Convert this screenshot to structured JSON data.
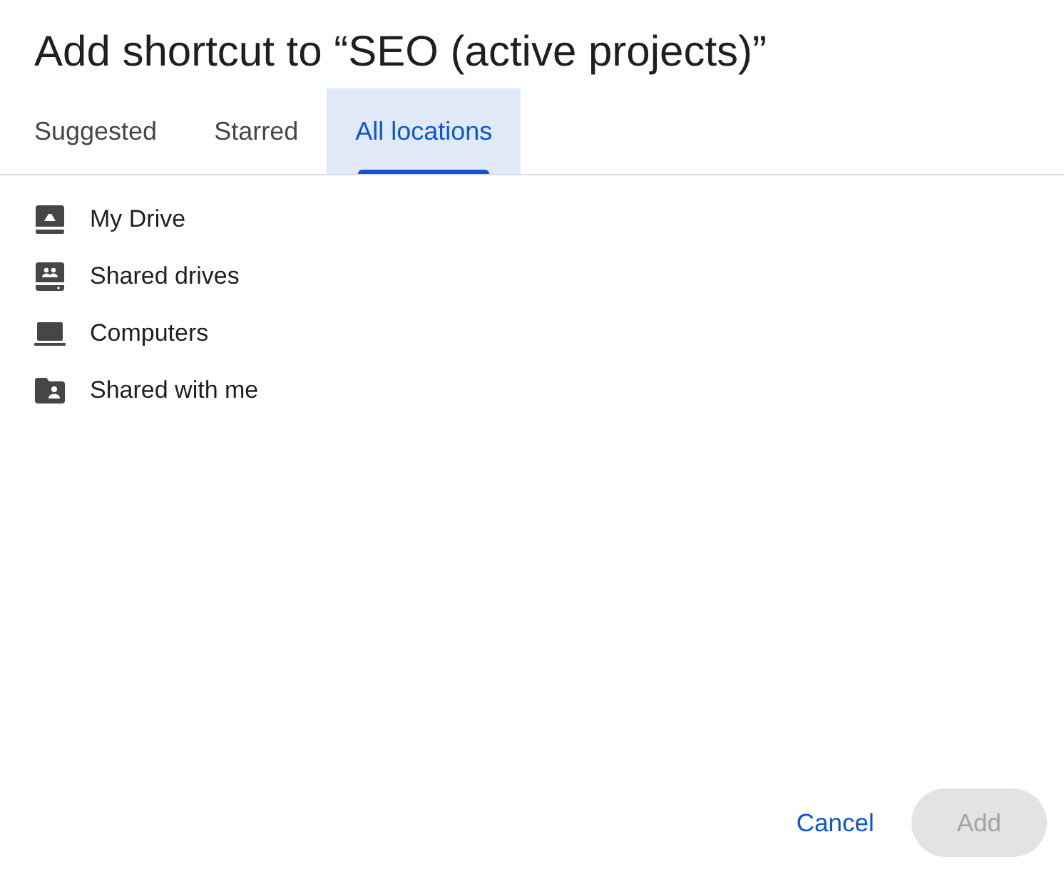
{
  "dialog": {
    "title": "Add shortcut to “SEO (active projects)”"
  },
  "tabs": [
    {
      "label": "Suggested",
      "selected": false
    },
    {
      "label": "Starred",
      "selected": false
    },
    {
      "label": "All locations",
      "selected": true
    }
  ],
  "locations": [
    {
      "kind": "drive",
      "label": "My Drive"
    },
    {
      "kind": "shared-drive",
      "label": "Shared drives"
    },
    {
      "kind": "computer",
      "label": "Computers"
    },
    {
      "kind": "shared-folder",
      "label": "Shared with me"
    }
  ],
  "buttons": [
    {
      "kind": "text",
      "label": "Cancel",
      "disabled": false
    },
    {
      "kind": "filled",
      "label": "Add",
      "disabled": true
    }
  ]
}
